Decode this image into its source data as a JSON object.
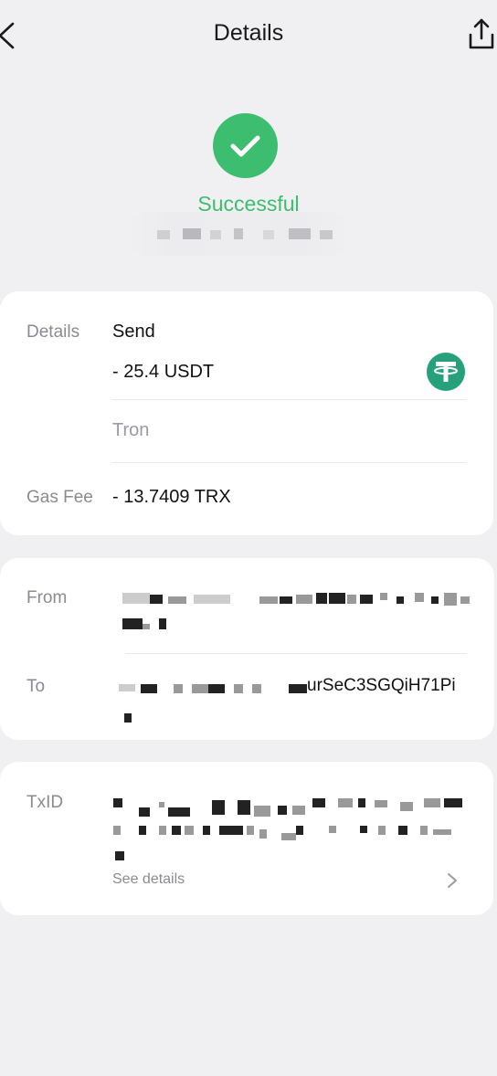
{
  "header": {
    "title": "Details"
  },
  "status": {
    "text": "Successful"
  },
  "details": {
    "label": "Details",
    "type": "Send",
    "amount": "- 25.4 USDT",
    "network": "Tron",
    "gas_label": "Gas Fee",
    "gas_value": "- 13.7409 TRX"
  },
  "addresses": {
    "from_label": "From",
    "to_label": "To",
    "to_tail": "urSeC3SGQiH71Pi"
  },
  "tx": {
    "label": "TxID",
    "see_details": "See details"
  },
  "colors": {
    "success": "#3dbd6f",
    "tether": "#26a17b"
  }
}
